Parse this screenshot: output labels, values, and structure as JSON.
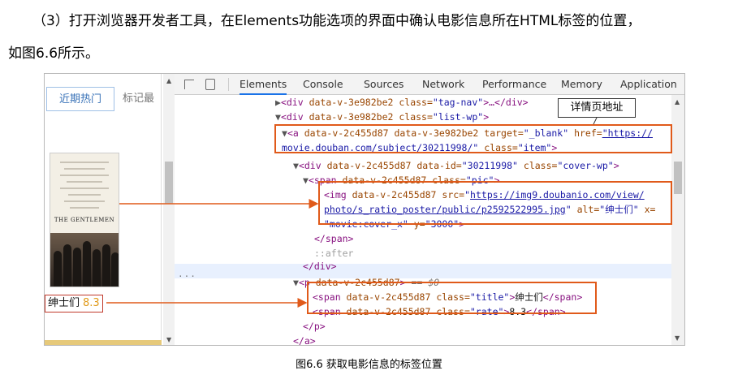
{
  "text": {
    "para1": "（3）打开浏览器开发者工具，在Elements功能选项的界面中确认电影信息所在HTML标签的位置，",
    "para2": "如图6.6所示。",
    "caption": "图6.6 获取电影信息的标签位置"
  },
  "page_panel": {
    "tab_active": "近期热门",
    "tab_other": "标记最",
    "poster_title": "THE GENTLEMEN",
    "movie_name": "绅士们",
    "movie_rate": "8.3"
  },
  "devtools": {
    "tabs": [
      "Elements",
      "Console",
      "Sources",
      "Network",
      "Performance",
      "Memory",
      "Application"
    ],
    "active_tab": "Elements",
    "gutter_dots": "...",
    "lines": [
      {
        "tri": "▶",
        "open": "<div ",
        "a1n": "data-v-3e982be2",
        "a1v": "",
        "a2n": " class=",
        "a2v": "\"tag-nav\"",
        "close": ">…</div>"
      },
      {
        "tri": "▼",
        "open": "<div ",
        "a1n": "data-v-3e982be2",
        "a2n": " class=",
        "a2v": "\"list-wp\"",
        "close": ">"
      },
      {
        "tri": "▼",
        "open": "<a ",
        "a1n": "data-v-2c455d87 data-v-3e982be2 target=",
        "a2v": "\"_blank\"",
        "a3n": " href=",
        "a3v": "\"https://"
      },
      {
        "url": "movie.douban.com/subject/30211998/",
        "rest_v": "\"",
        "a4n": " class=",
        "a4v": "\"item\"",
        "close": ">"
      },
      {
        "tri": "▼",
        "open": "<div ",
        "a1n": "data-v-2c455d87 data-id=",
        "a2v": "\"30211998\"",
        "a3n": " class=",
        "a3v": "\"cover-wp\"",
        "close": ">"
      },
      {
        "tri": "▼",
        "open": "<span ",
        "a1n": "data-v-2c455d87 class=",
        "a2v": "\"pic\"",
        "close": ">"
      },
      {
        "open": "<img ",
        "a1n": "data-v-2c455d87 src=",
        "a2v": "\"",
        "url": "https://img9.doubanio.com/view/"
      },
      {
        "url": "photo/s_ratio_poster/public/p2592522995.jpg",
        "rest_v": "\"",
        "a3n": " alt=",
        "a3v": "\"绅士们\"",
        "a4n": " x="
      },
      {
        "a4v": "\"movie:cover_x\"",
        "a5n": " y=",
        "a5v": "\"3000\"",
        "close": ">"
      },
      {
        "close": "</span>"
      },
      {
        "pseudo": "::after"
      },
      {
        "close": "</div>"
      },
      {
        "tri": "▼",
        "open": "<p ",
        "a1n": "data-v-2c455d87",
        "close": ">",
        "eq": " == $0"
      },
      {
        "open": "<span ",
        "a1n": "data-v-2c455d87 class=",
        "a2v": "\"title\"",
        "close": ">",
        "text": "绅士们",
        "end": "</span>"
      },
      {
        "open": "<span ",
        "a1n": "data-v-2c455d87 class=",
        "a2v": "\"rate\"",
        "close": ">",
        "text": "8.3",
        "end": "</span>"
      },
      {
        "close": "</p>"
      },
      {
        "close": "</a>"
      }
    ]
  },
  "callout": "详情页地址",
  "colors": {
    "annotation": "#e05a1a",
    "tag": "#881280",
    "attr_name": "#994500",
    "attr_value": "#1a1aa6"
  }
}
